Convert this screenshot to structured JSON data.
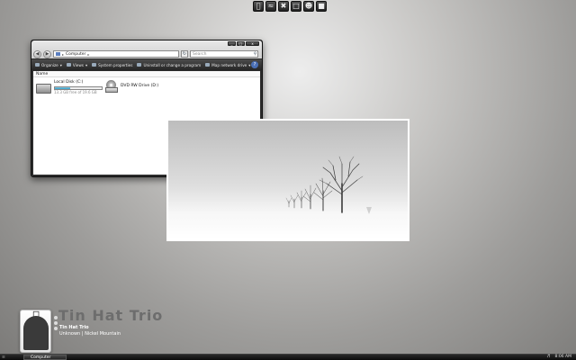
{
  "dock": {
    "icons": [
      "apple-icon",
      "wifi-icon",
      "tools-icon",
      "sticky-note-icon",
      "finder-icon",
      "window-icon"
    ]
  },
  "explorer": {
    "address": {
      "icon": "computer-icon",
      "path": "Computer"
    },
    "search_placeholder": "Search",
    "toolbar": {
      "organize": "Organize",
      "views": "Views",
      "system_properties": "System properties",
      "uninstall": "Uninstall or change a program",
      "map_drive": "Map network drive"
    },
    "column_header": "Name",
    "drives": [
      {
        "name": "Local Disk (C:)",
        "free_text": "13.3 GB free of 19.6 GB",
        "used_fraction": 0.32
      },
      {
        "name": "DVD RW Drive (D:)"
      }
    ]
  },
  "music": {
    "artist_title": "Tin Hat Trio",
    "track": "Tin Hat Trio",
    "album_line": "Unknown | Nickel Mountain"
  },
  "taskbar": {
    "task_label": "Computer",
    "clock": "8:06 AM"
  }
}
